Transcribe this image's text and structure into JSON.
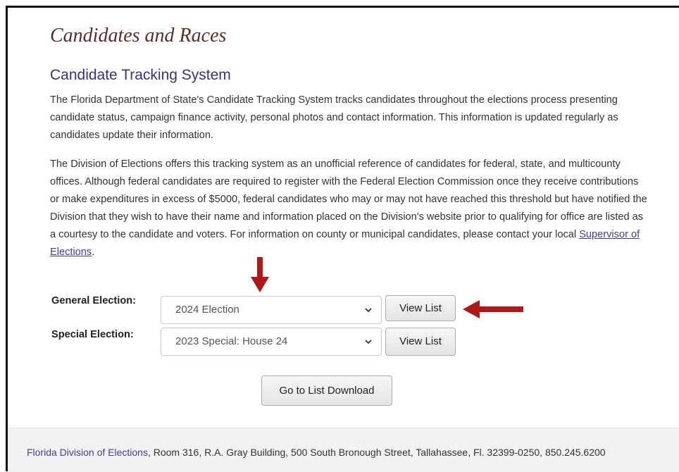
{
  "page": {
    "heading": "Candidates and Races"
  },
  "tracking": {
    "title": "Candidate Tracking System",
    "para1": "The Florida Department of State's Candidate Tracking System tracks candidates throughout the elections process presenting candidate status, campaign finance activity, personal photos and contact information. This information is updated regularly as candidates update their information.",
    "para2_before_link": "The Division of Elections offers this tracking system as an unofficial reference of candidates for federal, state, and multicounty offices. Although federal candidates are required to register with the Federal Election Commission once they receive contributions or make expenditures in excess of $5000, federal candidates who may or may not have reached this threshold but have notified the Division that they wish to have their name and information placed on the Division's website prior to qualifying for office are listed as a courtesy to the candidate and voters. For information on county or municipal candidates, please contact your local ",
    "para2_link": "Supervisor of Elections",
    "para2_after_link": "."
  },
  "form": {
    "general_label": "General Election:",
    "general_selected": "2024 Election",
    "special_label": "Special Election:",
    "special_selected": "2023 Special: House 24",
    "view_list_label": "View List",
    "download_label": "Go to List Download"
  },
  "footer": {
    "link": "Florida Division of Elections",
    "address": ", Room 316, R.A. Gray Building, 500 South Bronough Street, Tallahassee, Fl. 32399-0250, 850.245.6200"
  },
  "colors": {
    "annotation_arrow": "#b01818",
    "link": "#4a3b9b",
    "heading": "#5a2d2d"
  },
  "icons": {
    "select_chevron": "chevron-down-icon",
    "annotation_down": "red-arrow-down-icon",
    "annotation_left": "red-arrow-left-icon"
  }
}
